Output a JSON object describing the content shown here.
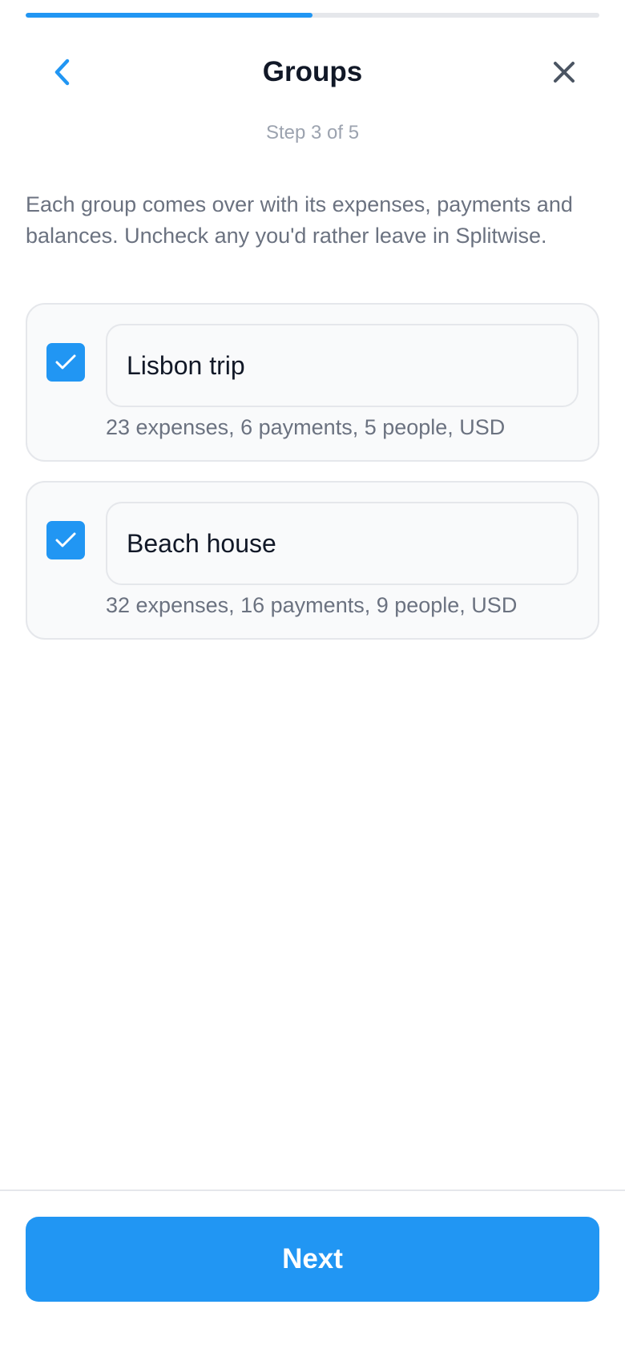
{
  "progress": {
    "step_fraction": 0.5,
    "color": "#2196f3"
  },
  "header": {
    "title": "Groups",
    "back_icon": "chevron-left-icon",
    "close_icon": "close-icon",
    "step_text": "Step 3 of 5"
  },
  "intro_text": "Each group comes over with its expenses, payments and balances. Uncheck any you'd rather leave in Splitwise.",
  "groups": [
    {
      "name": "Lisbon trip",
      "checked": true,
      "meta": "23 expenses, 6 payments, 5 people, USD"
    },
    {
      "name": "Beach house",
      "checked": true,
      "meta": "32 expenses, 16 payments, 9 people, USD"
    }
  ],
  "footer": {
    "next_label": "Next"
  },
  "colors": {
    "accent": "#2196f3",
    "muted_text": "#6b7280",
    "step_text": "#9ca3af"
  }
}
